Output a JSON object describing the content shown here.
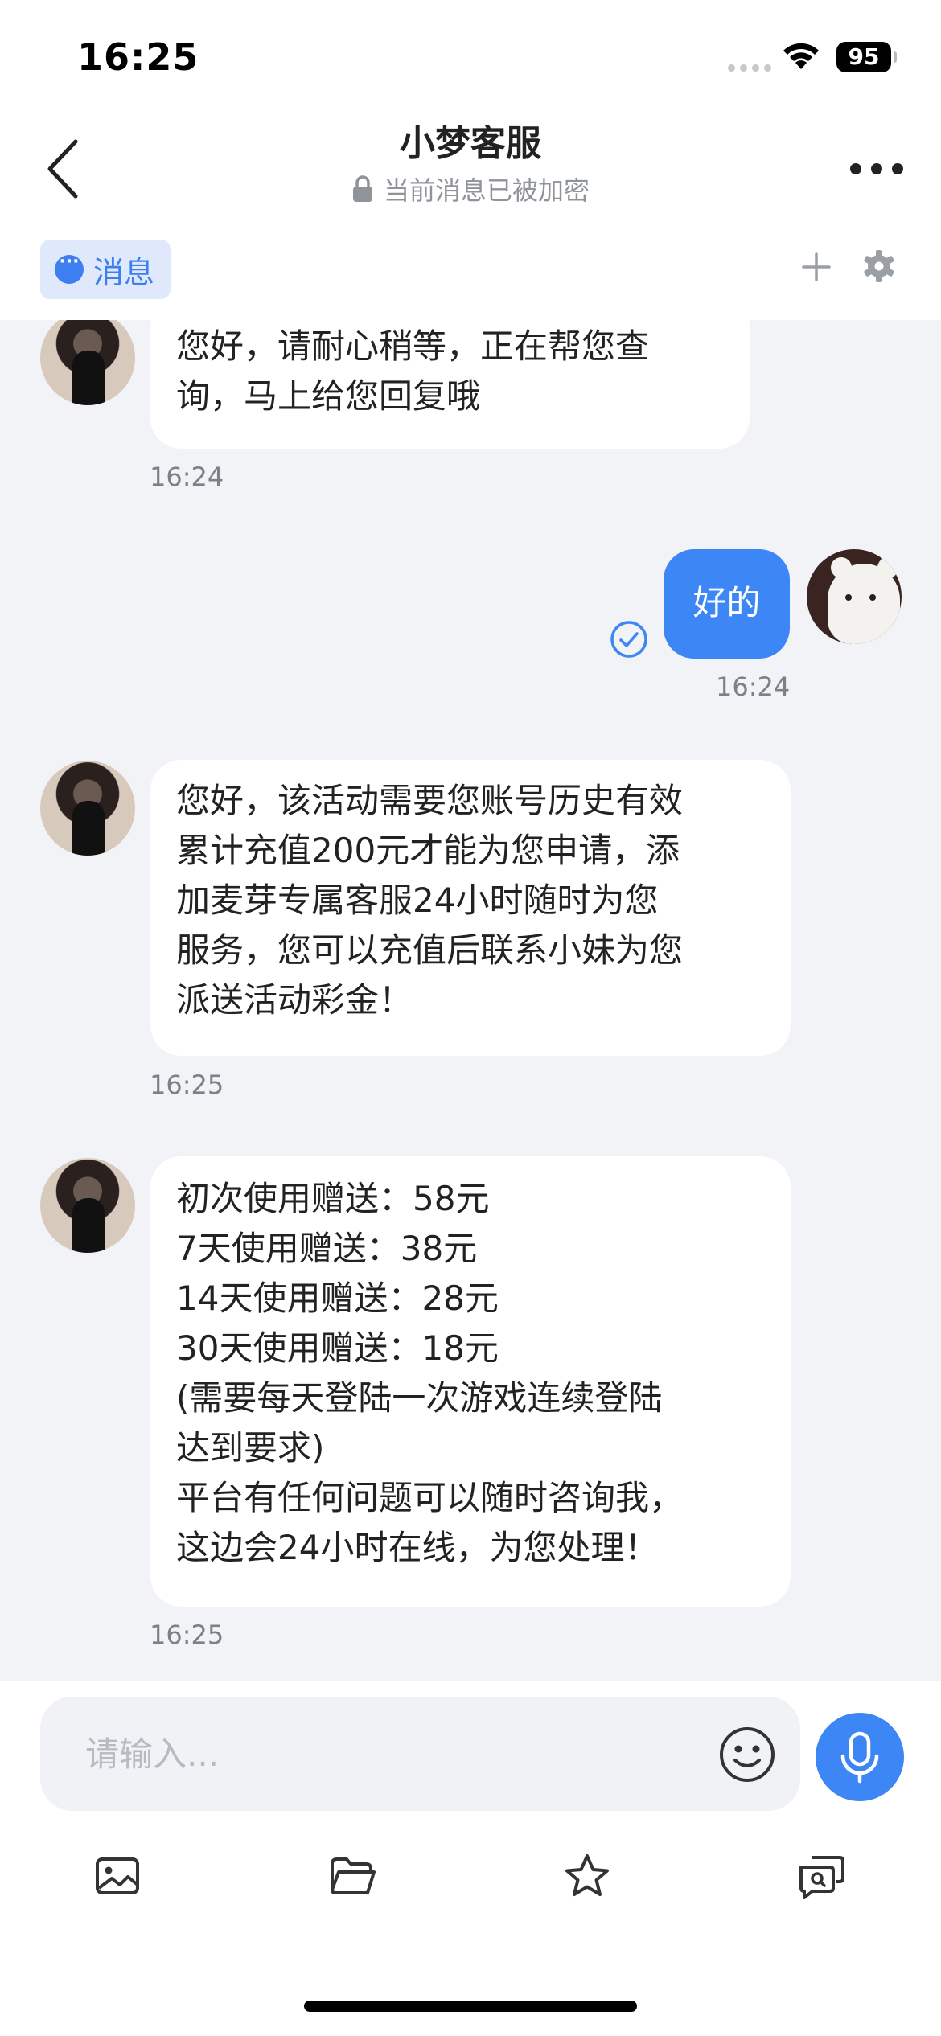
{
  "status_bar": {
    "time": "16:25",
    "battery": "95"
  },
  "header": {
    "title": "小梦客服",
    "subtitle": "当前消息已被加密"
  },
  "tab": {
    "label": "消息"
  },
  "messages": [
    {
      "from": "agent",
      "text": "您好，请耐心稍等，正在帮您查\n询，马上给您回复哦",
      "time": "16:24"
    },
    {
      "from": "me",
      "text": "好的",
      "time": "16:24",
      "status": "read"
    },
    {
      "from": "agent",
      "text": "您好，该活动需要您账号历史有效\n累计充值200元才能为您申请，添\n加麦芽专属客服24小时随时为您\n服务，您可以充值后联系小妹为您\n派送活动彩金！",
      "time": "16:25"
    },
    {
      "from": "agent",
      "text": "初次使用赠送：58元\n7天使用赠送：38元\n14天使用赠送：28元\n30天使用赠送：18元\n(需要每天登陆一次游戏连续登陆\n达到要求)\n平台有任何问题可以随时咨询我，\n这边会24小时在线，为您处理！",
      "time": "16:25"
    }
  ],
  "input": {
    "placeholder": "请输入..."
  },
  "icons": {
    "back": "chevron-left-icon",
    "more": "more-horizontal-icon",
    "lock": "lock-icon",
    "message": "message-bubble-icon",
    "plus": "plus-icon",
    "settings": "gear-icon",
    "emoji": "smiley-icon",
    "mic": "microphone-icon",
    "image": "image-icon",
    "folder": "folder-icon",
    "star": "star-icon",
    "switch": "chat-switch-icon"
  },
  "colors": {
    "accent": "#3d86f5",
    "chat_bg": "#f2f3f6",
    "bubble_agent": "#ffffff",
    "timestamp": "#7d8187"
  }
}
